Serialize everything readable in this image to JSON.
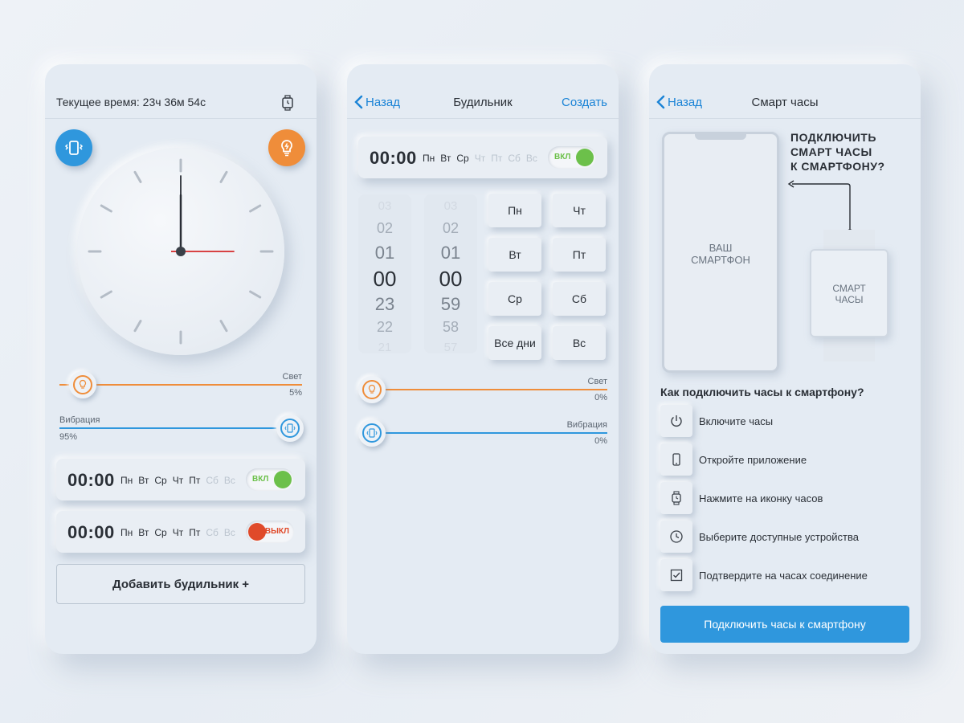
{
  "colors": {
    "accent": "#1a83d6",
    "primary": "#2f97dd",
    "light": "#ef8d3a",
    "vibration": "#2f97dd",
    "on": "#6cc04a",
    "off": "#e04a2a"
  },
  "screen1": {
    "current_time": "Текущее время: 23ч 36м 54с",
    "clock": {
      "hours": 0,
      "minutes": 0,
      "seconds": 15
    },
    "light": {
      "label": "Свет",
      "value": "5%",
      "level": 0.05
    },
    "vibration": {
      "label": "Вибрация",
      "value": "95%",
      "level": 0.95
    },
    "alarms": [
      {
        "time": "00:00",
        "days": [
          {
            "d": "Пн",
            "on": true
          },
          {
            "d": "Вт",
            "on": true
          },
          {
            "d": "Ср",
            "on": true
          },
          {
            "d": "Чт",
            "on": true
          },
          {
            "d": "Пт",
            "on": true
          },
          {
            "d": "Сб",
            "on": false
          },
          {
            "d": "Вс",
            "on": false
          }
        ],
        "state": "ВКЛ",
        "enabled": true
      },
      {
        "time": "00:00",
        "days": [
          {
            "d": "Пн",
            "on": true
          },
          {
            "d": "Вт",
            "on": true
          },
          {
            "d": "Ср",
            "on": true
          },
          {
            "d": "Чт",
            "on": true
          },
          {
            "d": "Пт",
            "on": true
          },
          {
            "d": "Сб",
            "on": false
          },
          {
            "d": "Вс",
            "on": false
          }
        ],
        "state": "ВЫКЛ",
        "enabled": false
      }
    ],
    "add_button": "Добавить будильник +"
  },
  "screen2": {
    "back": "Назад",
    "title": "Будильник",
    "action": "Создать",
    "alarm": {
      "time": "00:00",
      "days": [
        {
          "d": "Пн",
          "on": true
        },
        {
          "d": "Вт",
          "on": true
        },
        {
          "d": "Ср",
          "on": true
        },
        {
          "d": "Чт",
          "on": false
        },
        {
          "d": "Пт",
          "on": false
        },
        {
          "d": "Сб",
          "on": false
        },
        {
          "d": "Вс",
          "on": false
        }
      ],
      "state": "ВКЛ",
      "enabled": true
    },
    "hours": [
      "03",
      "02",
      "01",
      "00",
      "23",
      "22",
      "21"
    ],
    "minutes": [
      "03",
      "02",
      "01",
      "00",
      "59",
      "58",
      "57"
    ],
    "day_buttons": [
      "Пн",
      "Чт",
      "Вт",
      "Пт",
      "Ср",
      "Сб",
      "Все дни",
      "Вс"
    ],
    "light": {
      "label": "Свет",
      "value": "0%",
      "level": 0
    },
    "vibration": {
      "label": "Вибрация",
      "value": "0%",
      "level": 0
    }
  },
  "screen3": {
    "back": "Назад",
    "title": "Смарт часы",
    "phone_label": "ВАШ\nСМАРТФОН",
    "connect_title": "ПОДКЛЮЧИТЬ\nСМАРТ ЧАСЫ\nК СМАРТФОНУ?",
    "watch_label": "СМАРТ\nЧАСЫ",
    "how_title": "Как подключить часы к смартфону?",
    "steps": [
      {
        "icon": "power-icon",
        "text": "Включите часы"
      },
      {
        "icon": "phone-icon",
        "text": "Откройте приложение"
      },
      {
        "icon": "watch-icon",
        "text": "Нажмите на иконку часов"
      },
      {
        "icon": "clock-icon",
        "text": "Выберите доступные устройства"
      },
      {
        "icon": "checkbox-icon",
        "text": "Подтвердите на часах соединение"
      }
    ],
    "button": "Подключить часы к смартфону"
  }
}
